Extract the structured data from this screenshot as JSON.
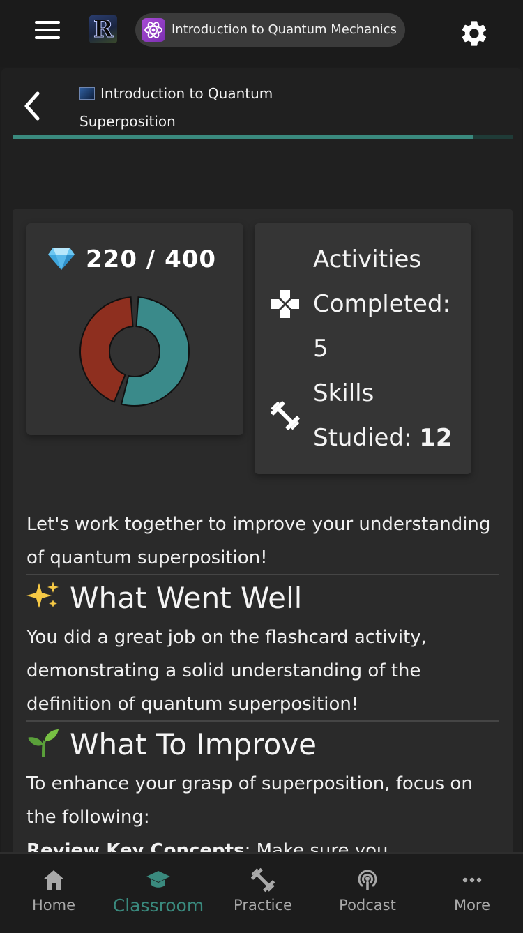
{
  "header": {
    "course_chip_label": "Introduction to Quantum Mechanics",
    "app_logo_letter": "R"
  },
  "lesson": {
    "title_line1": "Introduction to Quantum",
    "title_line2": "Superposition",
    "progress_fraction": 0.92
  },
  "score": {
    "text": "220 / 400",
    "earned": 220,
    "total": 400,
    "donut_colors": {
      "earned": "#3a8a8a",
      "remaining": "#8e2f1f"
    }
  },
  "stats": {
    "activities_line1": "Activities",
    "activities_line2": "Completed:",
    "activities_value": "5",
    "skills_line1": "Skills",
    "skills_line2": "Studied:",
    "skills_value": "12"
  },
  "feedback": {
    "intro": "Let's work together to improve your understanding of quantum superposition!",
    "went_well_heading": "What Went Well",
    "went_well_text": "You did a great job on the flashcard activity, demonstrating a solid understanding of the definition of quantum superposition!",
    "improve_heading": "What To Improve",
    "improve_text": "To enhance your grasp of superposition, focus on the following:",
    "improve_bullet_bold": "Review Key Concepts",
    "improve_bullet_rest": ": Make sure you"
  },
  "bottom_nav": {
    "items": [
      {
        "label": "Home",
        "icon": "home-icon"
      },
      {
        "label": "Classroom",
        "icon": "graduation-cap-icon",
        "active": true
      },
      {
        "label": "Practice",
        "icon": "dumbbell-icon"
      },
      {
        "label": "Podcast",
        "icon": "podcast-icon"
      },
      {
        "label": "More",
        "icon": "more-dots-icon"
      }
    ]
  },
  "colors": {
    "accent": "#3a8a7e",
    "background": "#1c1c1c",
    "card": "#2a2a2a"
  }
}
